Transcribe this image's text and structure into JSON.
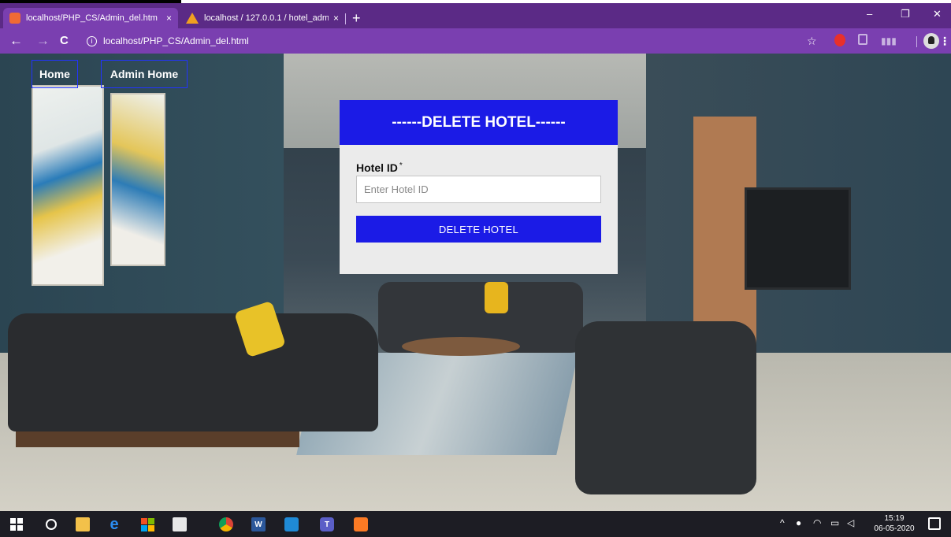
{
  "browser": {
    "tabs": [
      {
        "title": "localhost/PHP_CS/Admin_del.htm",
        "close": "×"
      },
      {
        "title": "localhost / 127.0.0.1 / hotel_adm",
        "close": "×"
      }
    ],
    "new_tab": "+",
    "window_controls": {
      "minimize": "–",
      "restore": "❐",
      "close": "✕"
    },
    "nav": {
      "back": "←",
      "forward": "→",
      "reload": "C"
    },
    "url": "localhost/PHP_CS/Admin_del.html",
    "bookmark": "☆",
    "menu": "⋮"
  },
  "page": {
    "nav_links": {
      "home": "Home",
      "admin_home": "Admin Home"
    },
    "form": {
      "title": "------DELETE HOTEL------",
      "field_label": "Hotel ID",
      "required_mark": "*",
      "field_placeholder": "Enter Hotel ID",
      "field_value": "",
      "submit_label": "DELETE HOTEL"
    },
    "colors": {
      "accent": "#1b1be6",
      "link_border": "#2233ff",
      "card_bg": "#ebebeb"
    }
  },
  "taskbar": {
    "clock_time": "15:19",
    "clock_date": "06-05-2020",
    "tray_chevron": "^",
    "icons": [
      "windows-start-icon",
      "search-icon",
      "file-explorer-icon",
      "edge-icon",
      "store-icon",
      "app-icon",
      "chrome-icon",
      "word-icon",
      "paint-icon",
      "teams-icon",
      "xampp-icon"
    ]
  }
}
